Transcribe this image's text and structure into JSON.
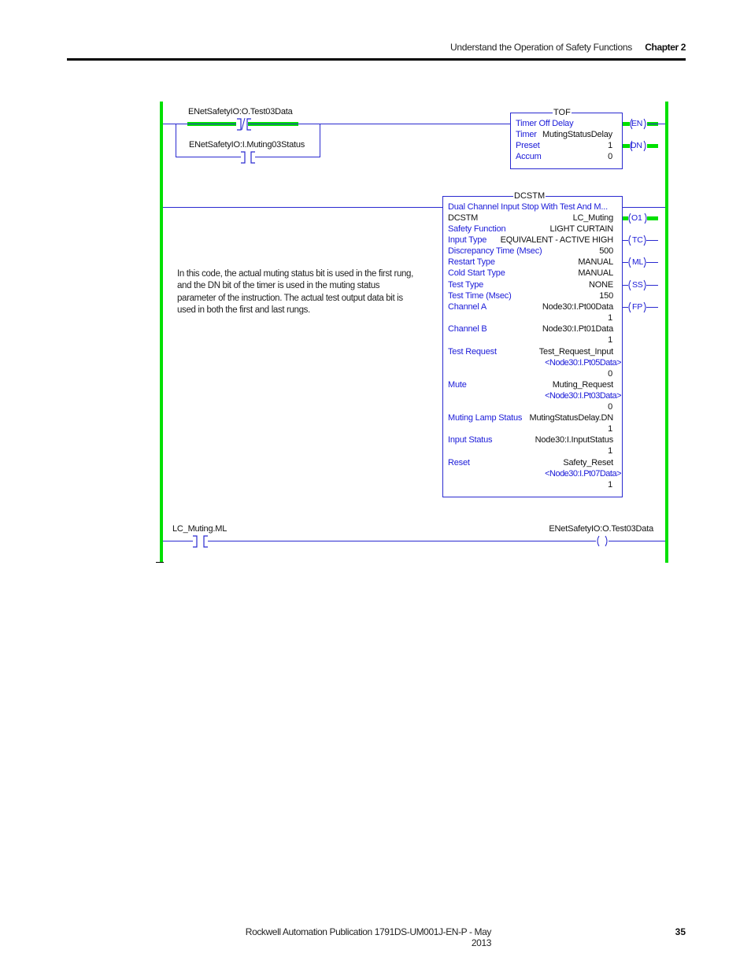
{
  "header": {
    "section_title": "Understand the Operation of Safety Functions",
    "chapter": "Chapter 2"
  },
  "footer": {
    "publication": "Rockwell Automation Publication 1791DS-UM001J-EN-P - May 2013",
    "page_number": "35"
  },
  "note": "In this code, the actual muting status bit is used in the first rung, and the DN bit of the timer is used in the muting status parameter of the instruction. The actual test output data bit is used in both the first and last rungs.",
  "colors": {
    "energized": "#00e000",
    "wire": "#2a2ad0",
    "param_label": "#1a1ad8"
  },
  "rung1": {
    "contact_xio_tag": "ENetSafetyIO:O.Test03Data",
    "contact_xic_tag": "ENetSafetyIO:I.Muting03Status",
    "tof": {
      "name": "TOF",
      "description": "Timer Off Delay",
      "timer_label": "Timer",
      "timer_value": "MutingStatusDelay",
      "preset_label": "Preset",
      "preset_value": "1",
      "accum_label": "Accum",
      "accum_value": "0",
      "outputs": [
        "EN",
        "DN"
      ]
    }
  },
  "rung2": {
    "dcstm": {
      "name": "DCSTM",
      "description": "Dual Channel Input Stop With Test And M...",
      "params": [
        {
          "label": "DCSTM",
          "value": "LC_Muting",
          "label_blue": false
        },
        {
          "label": "Safety Function",
          "value": "LIGHT CURTAIN",
          "label_blue": true
        },
        {
          "label": "Input Type",
          "value": "EQUIVALENT - ACTIVE HIGH",
          "label_blue": true
        },
        {
          "label": "Discrepancy Time (Msec)",
          "value": "500",
          "label_blue": true
        },
        {
          "label": "Restart Type",
          "value": "MANUAL",
          "label_blue": true
        },
        {
          "label": "Cold Start Type",
          "value": "MANUAL",
          "label_blue": true
        },
        {
          "label": "Test Type",
          "value": "NONE",
          "label_blue": true
        },
        {
          "label": "Test Time (Msec)",
          "value": "150",
          "label_blue": true
        },
        {
          "label": "Channel A",
          "value": "Node30:I.Pt00Data",
          "live": "1"
        },
        {
          "label": "Channel B",
          "value": "Node30:I.Pt01Data",
          "live": "1"
        },
        {
          "label": "Test Request",
          "value": "Test_Request_Input",
          "alias": "<Node30:I.Pt05Data>",
          "live": "0"
        },
        {
          "label": "Mute",
          "value": "Muting_Request",
          "alias": "<Node30:I.Pt03Data>",
          "live": "0"
        },
        {
          "label": "Muting Lamp Status",
          "value": "MutingStatusDelay.DN",
          "live": "1"
        },
        {
          "label": "Input Status",
          "value": "Node30:I.InputStatus",
          "live": "1"
        },
        {
          "label": "Reset",
          "value": "Safety_Reset",
          "alias": "<Node30:I.Pt07Data>",
          "live": "1"
        }
      ],
      "outputs": [
        "O1",
        "TC",
        "ML",
        "SS",
        "FP"
      ]
    }
  },
  "rung3": {
    "contact_tag": "LC_Muting.ML",
    "coil_tag": "ENetSafetyIO:O.Test03Data"
  }
}
